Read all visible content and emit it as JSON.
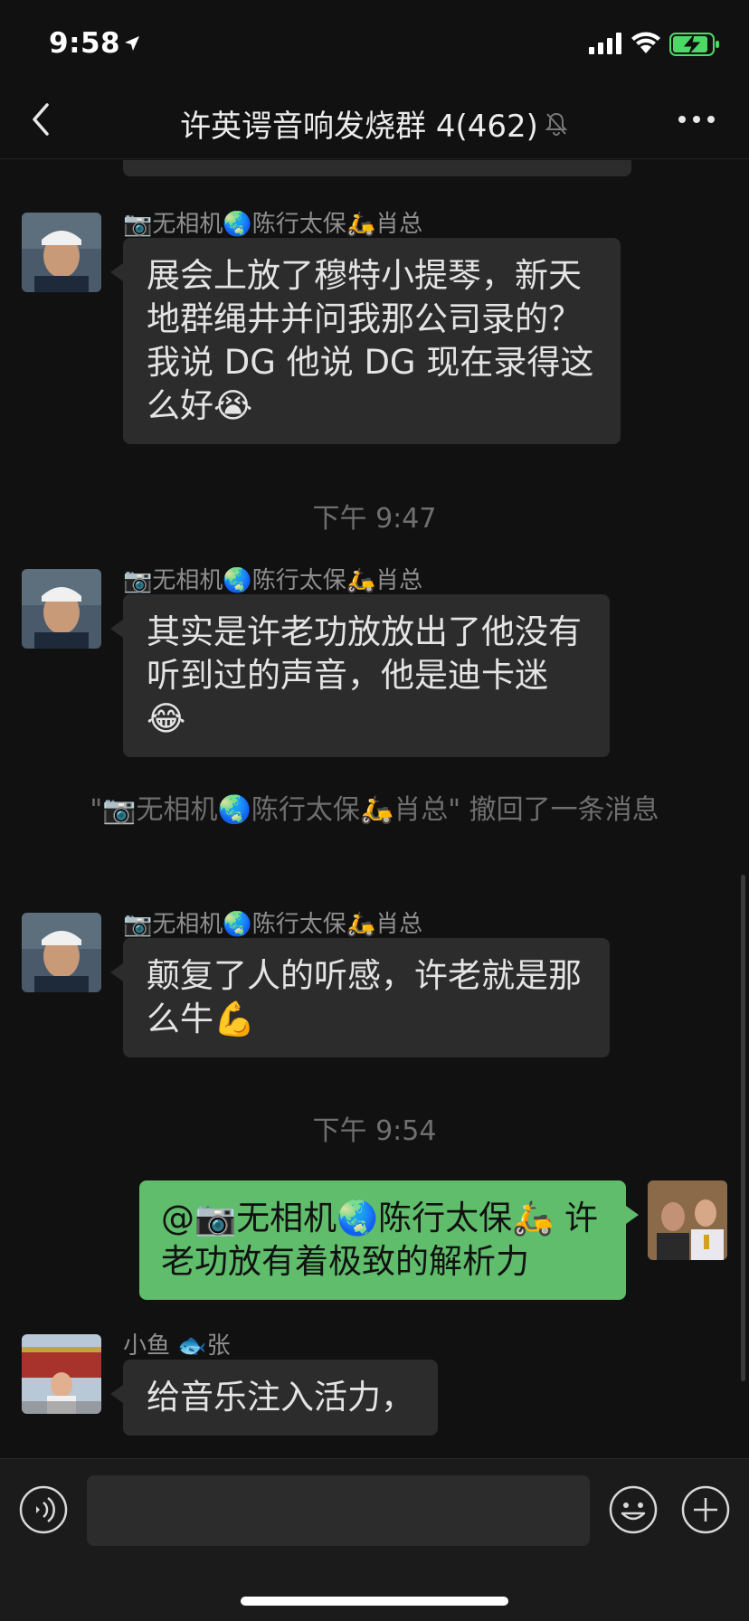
{
  "status_bar": {
    "time": "9:58"
  },
  "nav": {
    "title": "许英谔音响发烧群 4(462)"
  },
  "messages": [
    {
      "sender": "📷无相机🌏陈行太保🛵肖总",
      "text": "展会上放了穆特小提琴，新天地群绳井并问我那公司录的？我说 DG 他说 DG 现在录得这么好😭"
    },
    {
      "time": "下午 9:47"
    },
    {
      "sender": "📷无相机🌏陈行太保🛵肖总",
      "text": "其实是许老功放放出了他没有听到过的声音，他是迪卡迷😂"
    },
    {
      "recall": "\"📷无相机🌏陈行太保🛵肖总\" 撤回了一条消息"
    },
    {
      "sender": "📷无相机🌏陈行太保🛵肖总",
      "text": "颠复了人的听感，许老就是那么牛💪"
    },
    {
      "time": "下午 9:54"
    },
    {
      "outgoing": true,
      "text": "@📷无相机🌏陈行太保🛵 许老功放有着极致的解析力"
    },
    {
      "sender": "小鱼 🐟张",
      "text": "给音乐注入活力，"
    }
  ],
  "colors": {
    "background": "#111111",
    "incoming_bubble": "#2c2c2c",
    "outgoing_bubble": "#5fbd6b",
    "battery": "#4cd964"
  },
  "icons": [
    "location-arrow-icon",
    "signal-icon",
    "wifi-icon",
    "battery-charging-icon",
    "back-icon",
    "mute-bell-icon",
    "more-icon",
    "voice-icon",
    "emoji-icon",
    "plus-icon"
  ]
}
